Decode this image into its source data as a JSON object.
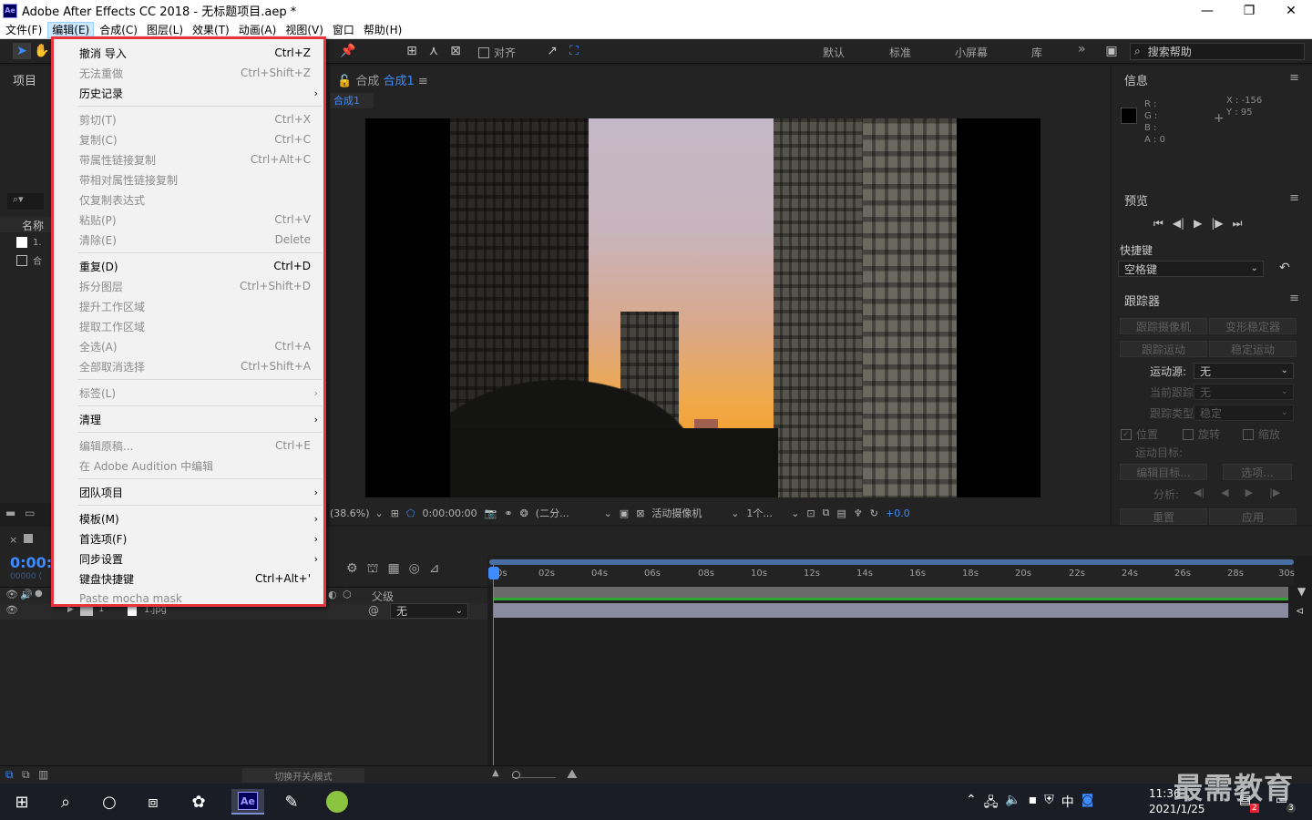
{
  "window": {
    "title": "Adobe After Effects CC 2018 - 无标题项目.aep *",
    "app_icon": "Ae",
    "minimize": "—",
    "maximize": "❐",
    "close": "✕"
  },
  "menubar": [
    "文件(F)",
    "编辑(E)",
    "合成(C)",
    "图层(L)",
    "效果(T)",
    "动画(A)",
    "视图(V)",
    "窗口",
    "帮助(H)"
  ],
  "toolbar": {
    "align_label": "对齐",
    "workspaces": [
      "默认",
      "标准",
      "小屏幕",
      "库"
    ],
    "more": "»",
    "search_placeholder": "搜索帮助"
  },
  "project_panel": {
    "title": "项目",
    "col_name": "名称",
    "item1": "1.",
    "item2": "合"
  },
  "comp_panel": {
    "title_prefix": "合成",
    "comp_name": "合成1",
    "menu": "≡",
    "tab": "合成1"
  },
  "comp_footer": {
    "zoom": "(38.6%)",
    "timecode": "0:00:00:00",
    "resolution": "(二分...",
    "camera": "活动摄像机",
    "views": "1个...",
    "exposure": "+0.0"
  },
  "info_panel": {
    "title": "信息",
    "labels": [
      "R :",
      "G :",
      "B :",
      "A : 0"
    ],
    "x": "X : -156",
    "y": "Y : 95"
  },
  "preview_panel": {
    "title": "预览",
    "shortcut_label": "快捷键",
    "shortcut_value": "空格键"
  },
  "tracker_panel": {
    "title": "跟踪器",
    "btn_camera": "跟踪摄像机",
    "btn_warp": "变形稳定器",
    "btn_motion": "跟踪运动",
    "btn_stabilize": "稳定运动",
    "motion_source_label": "运动源:",
    "motion_source_value": "无",
    "current_track_label": "当前跟踪:",
    "current_track_value": "无",
    "track_type_label": "跟踪类型:",
    "track_type_value": "稳定",
    "chk_position": "位置",
    "chk_rotation": "旋转",
    "chk_scale": "缩放",
    "target_label": "运动目标:",
    "btn_edit_target": "编辑目标...",
    "btn_options": "选项...",
    "analyze_label": "分析:",
    "btn_reset": "重置",
    "btn_apply": "应用"
  },
  "timeline": {
    "time": "0:00:",
    "frames": "00000 (",
    "parent_label": "父级",
    "layer_num": "1",
    "layer_name": "1.jpg",
    "parent_value": "无",
    "ticks": [
      "0s",
      "02s",
      "04s",
      "06s",
      "08s",
      "10s",
      "12s",
      "14s",
      "16s",
      "18s",
      "20s",
      "22s",
      "24s",
      "26s",
      "28s",
      "30s"
    ],
    "mode_toggle": "切换开关/模式"
  },
  "taskbar": {
    "clock_time": "11:36",
    "clock_date": "2021/1/25",
    "ime": "中",
    "notif_badge": "2",
    "action_badge": "3"
  },
  "watermark": "最需教育",
  "edit_menu": [
    {
      "label": "撤消 导入",
      "shortcut": "Ctrl+Z",
      "enabled": true
    },
    {
      "label": "无法重做",
      "shortcut": "Ctrl+Shift+Z",
      "enabled": false
    },
    {
      "label": "历史记录",
      "shortcut": "",
      "enabled": true,
      "submenu": true
    },
    {
      "sep": true
    },
    {
      "label": "剪切(T)",
      "shortcut": "Ctrl+X",
      "enabled": false
    },
    {
      "label": "复制(C)",
      "shortcut": "Ctrl+C",
      "enabled": false
    },
    {
      "label": "带属性链接复制",
      "shortcut": "Ctrl+Alt+C",
      "enabled": false
    },
    {
      "label": "带相对属性链接复制",
      "shortcut": "",
      "enabled": false
    },
    {
      "label": "仅复制表达式",
      "shortcut": "",
      "enabled": false
    },
    {
      "label": "粘贴(P)",
      "shortcut": "Ctrl+V",
      "enabled": false
    },
    {
      "label": "清除(E)",
      "shortcut": "Delete",
      "enabled": false
    },
    {
      "sep": true
    },
    {
      "label": "重复(D)",
      "shortcut": "Ctrl+D",
      "enabled": true
    },
    {
      "label": "拆分图层",
      "shortcut": "Ctrl+Shift+D",
      "enabled": false
    },
    {
      "label": "提升工作区域",
      "shortcut": "",
      "enabled": false
    },
    {
      "label": "提取工作区域",
      "shortcut": "",
      "enabled": false
    },
    {
      "label": "全选(A)",
      "shortcut": "Ctrl+A",
      "enabled": false
    },
    {
      "label": "全部取消选择",
      "shortcut": "Ctrl+Shift+A",
      "enabled": false
    },
    {
      "sep": true
    },
    {
      "label": "标签(L)",
      "shortcut": "",
      "enabled": false,
      "submenu": true
    },
    {
      "sep": true
    },
    {
      "label": "清理",
      "shortcut": "",
      "enabled": true,
      "submenu": true
    },
    {
      "sep": true
    },
    {
      "label": "编辑原稿...",
      "shortcut": "Ctrl+E",
      "enabled": false
    },
    {
      "label": "在 Adobe Audition 中编辑",
      "shortcut": "",
      "enabled": false
    },
    {
      "sep": true
    },
    {
      "label": "团队项目",
      "shortcut": "",
      "enabled": true,
      "submenu": true
    },
    {
      "sep": true
    },
    {
      "label": "模板(M)",
      "shortcut": "",
      "enabled": true,
      "submenu": true
    },
    {
      "label": "首选项(F)",
      "shortcut": "",
      "enabled": true,
      "submenu": true
    },
    {
      "label": "同步设置",
      "shortcut": "",
      "enabled": true,
      "submenu": true
    },
    {
      "label": "键盘快捷键",
      "shortcut": "Ctrl+Alt+'",
      "enabled": true
    },
    {
      "label": "Paste mocha mask",
      "shortcut": "",
      "enabled": false
    }
  ]
}
